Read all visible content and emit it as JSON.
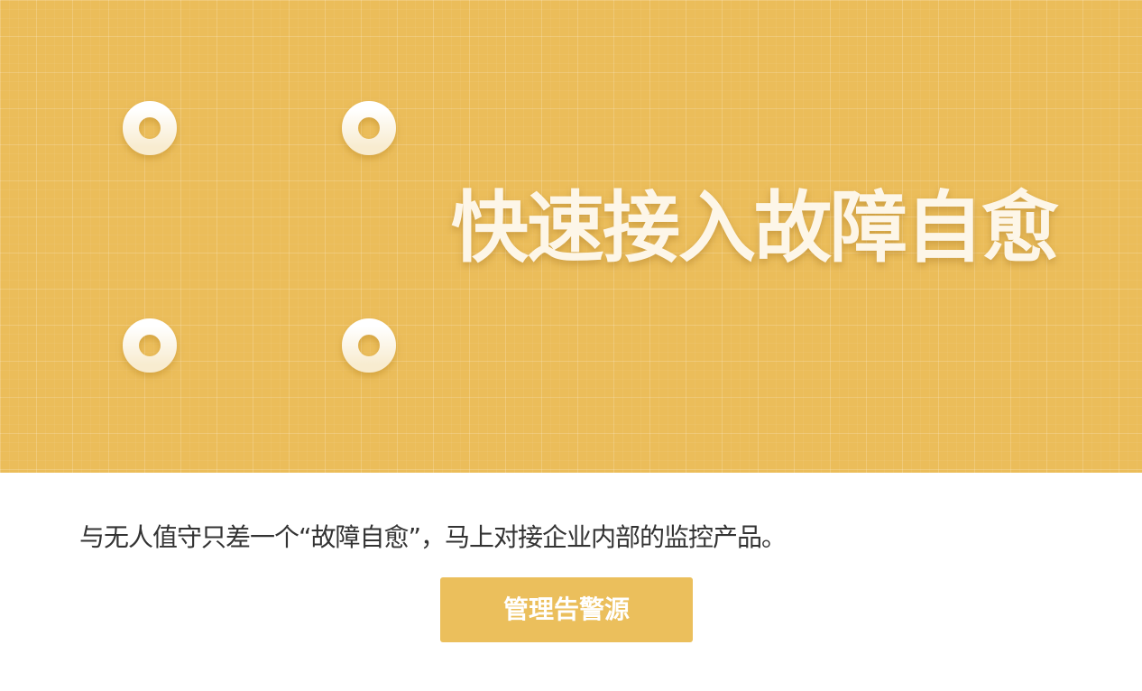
{
  "banner": {
    "title": "快速接入故障自愈",
    "icon": "add-frame-icon",
    "background_color": "#ebbd5a",
    "icon_color": "#fdf6e8"
  },
  "content": {
    "description": "与无人值守只差一个“故障自愈”，马上对接企业内部的监控产品。"
  },
  "actions": {
    "manage_alert_sources_label": "管理告警源",
    "button_color": "#ebbf5c"
  }
}
